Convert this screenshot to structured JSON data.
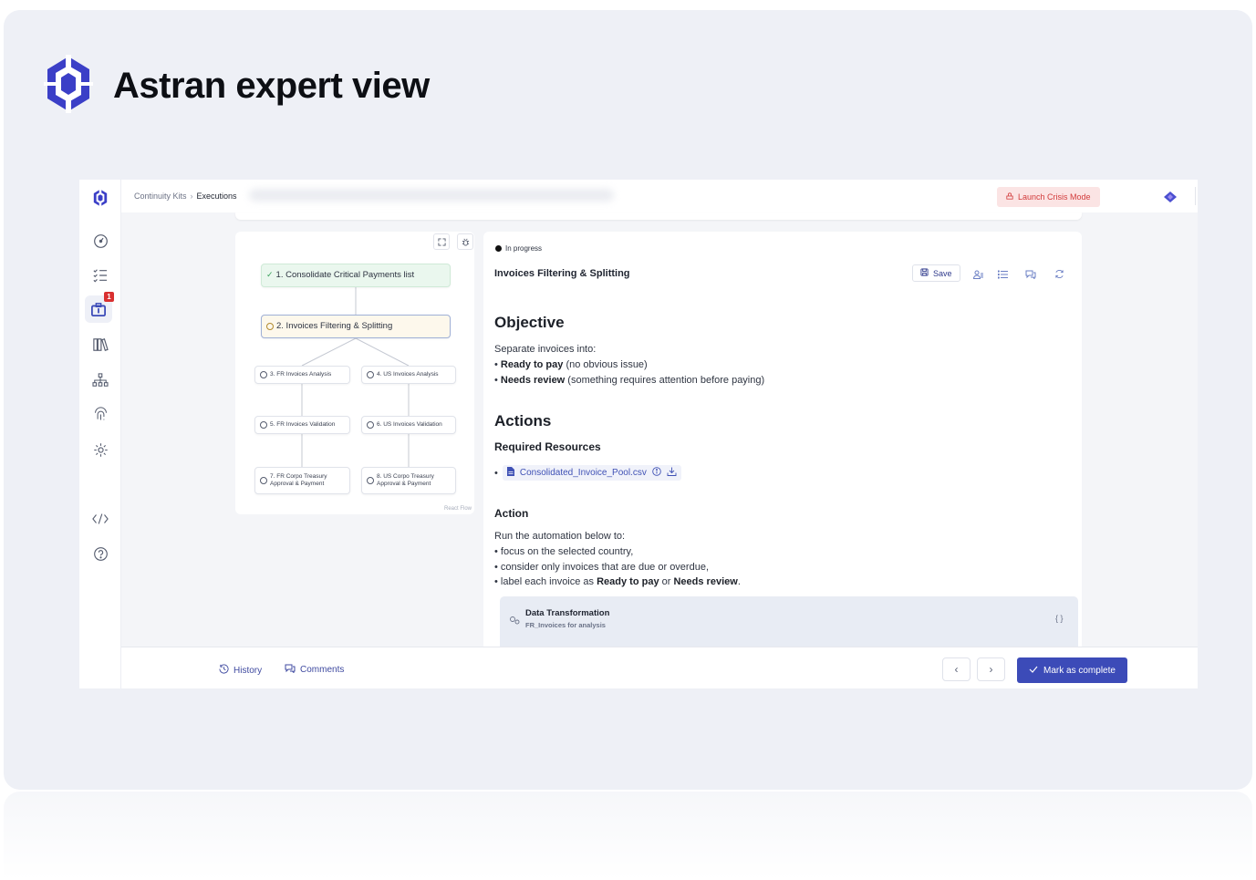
{
  "brand": {
    "title": "Astran expert view"
  },
  "sidebar": {
    "notification_count": "1"
  },
  "topbar": {
    "breadcrumb": [
      {
        "label": "Continuity Kits"
      },
      {
        "label": "Executions"
      }
    ],
    "crisis_button": "Launch Crisis Mode"
  },
  "flow": {
    "nodes": [
      {
        "label": "1. Consolidate Critical Payments list",
        "state": "done"
      },
      {
        "label": "2. Invoices Filtering & Splitting",
        "state": "current"
      },
      {
        "label": "3. FR Invoices Analysis"
      },
      {
        "label": "4. US Invoices Analysis"
      },
      {
        "label": "5. FR Invoices Validation"
      },
      {
        "label": "6. US Invoices Validation"
      },
      {
        "label": "7. FR Corpo Treasury Approval & Payment"
      },
      {
        "label": "8. US Corpo Treasury Approval & Payment"
      }
    ],
    "watermark": "React Flow"
  },
  "step": {
    "status": "In progress",
    "title": "Invoices Filtering & Splitting",
    "save_label": "Save",
    "objective": {
      "heading": "Objective",
      "intro": "Separate invoices into:",
      "items": [
        {
          "bold": "Ready to pay",
          "rest": " (no obvious issue)"
        },
        {
          "bold": "Needs review",
          "rest": " (something requires attention before paying)"
        }
      ]
    },
    "actions": {
      "heading": "Actions",
      "resources_heading": "Required Resources",
      "resource_file": "Consolidated_Invoice_Pool.csv",
      "action_heading": "Action",
      "action_intro": "Run the automation below to:",
      "bullet1": "focus on the selected country,",
      "bullet2": "consider only invoices that are due or overdue,",
      "bullet3_a": "label each invoice as ",
      "bullet3_b": "Ready to pay",
      "bullet3_c": " or ",
      "bullet3_d": "Needs review",
      "bullet3_e": "."
    },
    "transformation": {
      "title": "Data Transformation",
      "subtitle": "FR_Invoices for analysis"
    }
  },
  "footer": {
    "history": "History",
    "comments": "Comments",
    "mark_complete": "Mark as complete"
  },
  "colors": {
    "accent": "#3c4bb8",
    "crisis": "#d23b3b",
    "done_node": "#eaf7ee",
    "current_node": "#fdf8ec"
  }
}
